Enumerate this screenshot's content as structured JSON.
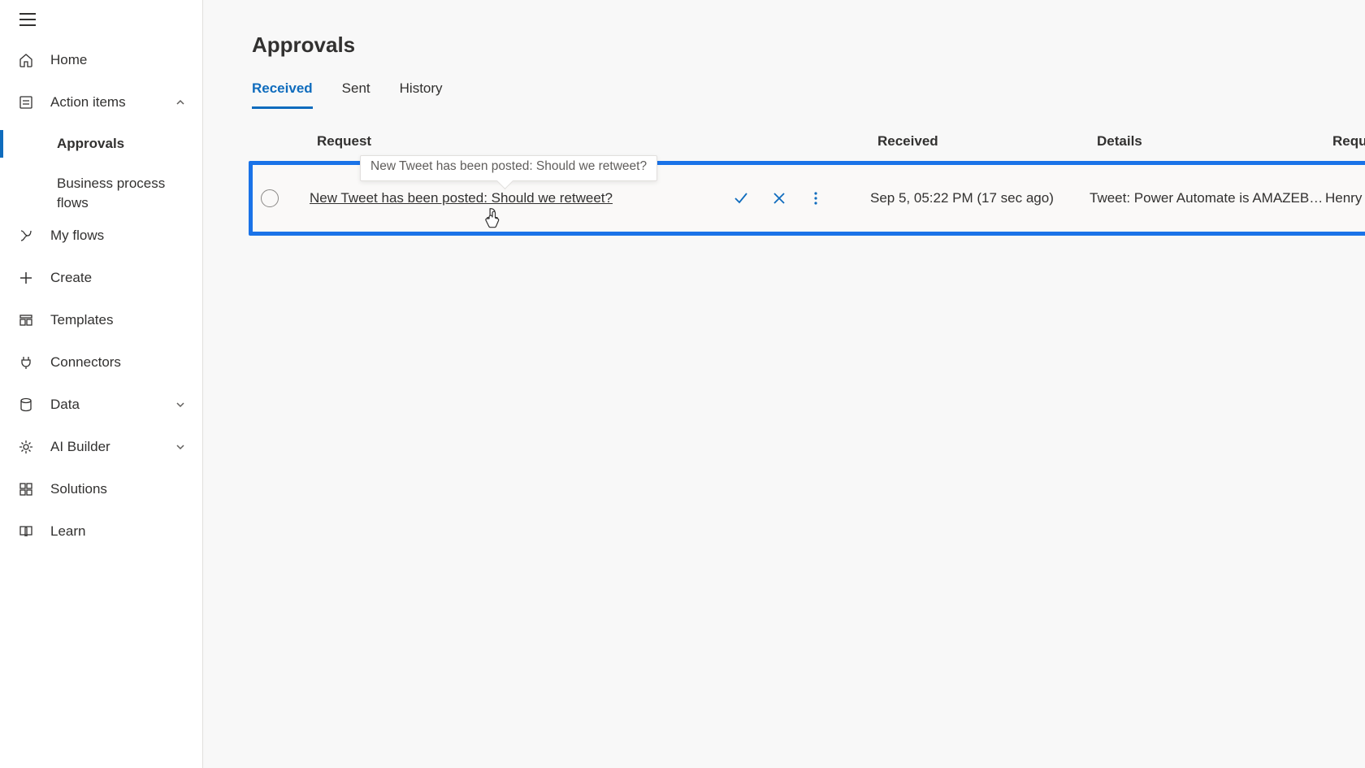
{
  "sidebar": {
    "items": {
      "home": "Home",
      "action_items": "Action items",
      "approvals": "Approvals",
      "bpf": "Business process flows",
      "my_flows": "My flows",
      "create": "Create",
      "templates": "Templates",
      "connectors": "Connectors",
      "data": "Data",
      "ai_builder": "AI Builder",
      "solutions": "Solutions",
      "learn": "Learn"
    }
  },
  "page": {
    "title": "Approvals"
  },
  "tabs": {
    "received": "Received",
    "sent": "Sent",
    "history": "History"
  },
  "table": {
    "headers": {
      "request": "Request",
      "received": "Received",
      "details": "Details",
      "requester": "Requester"
    },
    "tooltip": "New Tweet has been posted: Should we retweet?",
    "row": {
      "title": "New Tweet has been posted: Should we retweet?",
      "received": "Sep 5, 05:22 PM (17 sec ago)",
      "details": "Tweet: Power Automate is AMAZEBA…",
      "requester": "Henry Legge"
    }
  }
}
